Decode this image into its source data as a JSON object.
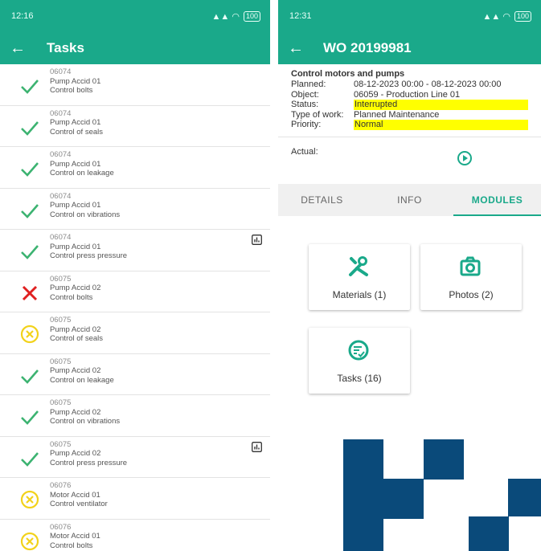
{
  "left": {
    "status": {
      "time": "12:16",
      "battery": "100"
    },
    "title": "Tasks",
    "tasks": [
      {
        "code": "06074",
        "equipment": "Pump Accid 01",
        "task": "Control bolts",
        "status": "ok",
        "chart": false
      },
      {
        "code": "06074",
        "equipment": "Pump Accid 01",
        "task": "Control of seals",
        "status": "ok",
        "chart": false
      },
      {
        "code": "06074",
        "equipment": "Pump Accid 01",
        "task": "Control on leakage",
        "status": "ok",
        "chart": false
      },
      {
        "code": "06074",
        "equipment": "Pump Accid 01",
        "task": "Control on vibrations",
        "status": "ok",
        "chart": false
      },
      {
        "code": "06074",
        "equipment": "Pump Accid 01",
        "task": "Control press pressure",
        "status": "ok",
        "chart": true
      },
      {
        "code": "06075",
        "equipment": "Pump Accid 02",
        "task": "Control bolts",
        "status": "failed",
        "chart": false
      },
      {
        "code": "06075",
        "equipment": "Pump Accid 02",
        "task": "Control of seals",
        "status": "pending",
        "chart": false
      },
      {
        "code": "06075",
        "equipment": "Pump Accid 02",
        "task": "Control on leakage",
        "status": "ok",
        "chart": false
      },
      {
        "code": "06075",
        "equipment": "Pump Accid 02",
        "task": "Control on vibrations",
        "status": "ok",
        "chart": false
      },
      {
        "code": "06075",
        "equipment": "Pump Accid 02",
        "task": "Control press pressure",
        "status": "ok",
        "chart": true
      },
      {
        "code": "06076",
        "equipment": "Motor Accid 01",
        "task": "Control ventilator",
        "status": "pending",
        "chart": false
      },
      {
        "code": "06076",
        "equipment": "Motor Accid 01",
        "task": "Control bolts",
        "status": "pending",
        "chart": false
      }
    ]
  },
  "right": {
    "status": {
      "time": "12:31",
      "battery": "100"
    },
    "title": "WO 20199981",
    "header": "Control motors and pumps",
    "fields": {
      "planned_label": "Planned:",
      "planned": "08-12-2023 00:00  -  08-12-2023 00:00",
      "object_label": "Object:",
      "object": "06059 - Production Line 01",
      "status_label": "Status:",
      "status": "Interrupted",
      "type_label": "Type of work:",
      "type": "Planned Maintenance",
      "priority_label": "Priority:",
      "priority": "Normal"
    },
    "actual_label": "Actual:",
    "tabs": [
      "DETAILS",
      "INFO",
      "MODULES"
    ],
    "modules": {
      "materials": "Materials (1)",
      "photos": "Photos (2)",
      "tasks": "Tasks (16)"
    }
  },
  "colors": {
    "accent": "#1aa98a",
    "ok": "#3cb371",
    "failed": "#e02020",
    "pending": "#f2d21b",
    "highlight": "#ffff00",
    "deco": "#0a4a7a"
  },
  "icons": {
    "back": "arrow-left-icon",
    "play": "play-circle-icon",
    "materials": "tools-icon",
    "photos": "camera-icon",
    "tasks": "task-list-icon"
  }
}
